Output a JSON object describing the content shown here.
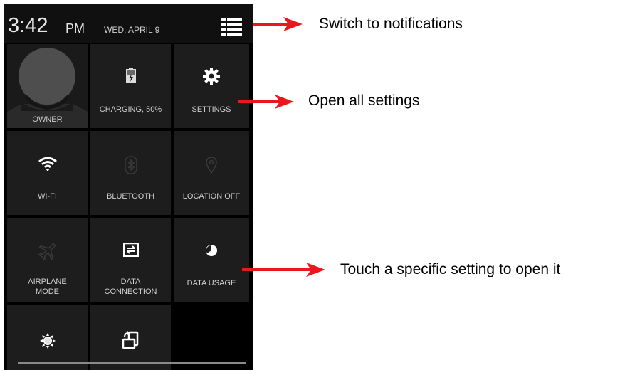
{
  "status_bar": {
    "time": "3:42",
    "ampm": "PM",
    "date": "WED, APRIL 9",
    "switch_icon": "list-icon"
  },
  "tiles": [
    {
      "label": "OWNER",
      "icon": "avatar"
    },
    {
      "label": "CHARGING, 50%",
      "icon": "battery-charging-icon"
    },
    {
      "label": "SETTINGS",
      "icon": "gear-icon"
    },
    {
      "label": "WI-FI",
      "icon": "wifi-icon"
    },
    {
      "label": "BLUETOOTH",
      "icon": "bluetooth-icon"
    },
    {
      "label": "LOCATION OFF",
      "icon": "location-icon"
    },
    {
      "label_line1": "AIRPLANE",
      "label_line2": "MODE",
      "icon": "airplane-icon"
    },
    {
      "label_line1": "DATA",
      "label_line2": "CONNECTION",
      "icon": "data-connection-icon"
    },
    {
      "label": "DATA USAGE",
      "icon": "data-usage-icon"
    },
    {
      "label": "",
      "icon": "brightness-icon"
    },
    {
      "label": "",
      "icon": "rotation-icon"
    }
  ],
  "annotations": {
    "switch": "Switch to notifications",
    "settings": "Open all settings",
    "touch": "Touch a specific setting to open it"
  },
  "colors": {
    "arrow": "#e8181c",
    "tile_bg": "#1d1d1d",
    "panel_bg": "#000000"
  }
}
